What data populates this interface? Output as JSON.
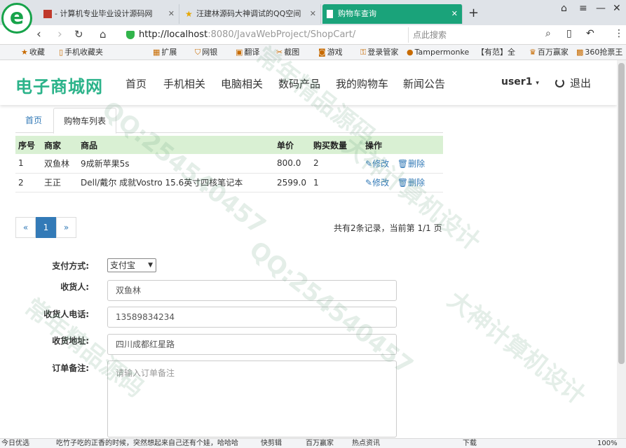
{
  "browser": {
    "tabs": [
      {
        "title": "- 计算机专业毕业设计源码网",
        "icon": "red-square-icon"
      },
      {
        "title": "汪建林源码大神调试的QQ空间",
        "icon": "star-icon"
      },
      {
        "title": "购物车查询",
        "icon": "page-icon"
      }
    ],
    "address": {
      "host": "http://localhost",
      "path": ":8080/JavaWebProject/ShopCart/"
    },
    "search_placeholder": "点此搜索",
    "bookmarks": [
      "收藏",
      "手机收藏夹",
      "扩展",
      "网银",
      "翻译",
      "截图",
      "游戏",
      "登录管家",
      "Tampermonke",
      "【有范】全",
      "百万赢家",
      "360抢票王"
    ],
    "status_items": [
      "今日优选",
      "吃竹子吃的正香的时候，突然想起来自己还有个娃，哈哈哈",
      "快剪辑",
      "百万赢家",
      "热点资讯",
      "下载",
      "100%"
    ]
  },
  "site": {
    "brand": "电子商城网",
    "nav": [
      "首页",
      "手机相关",
      "电脑相关",
      "数码产品",
      "我的购物车",
      "新闻公告"
    ],
    "user": "user1",
    "logout": "退出",
    "tabs": {
      "home": "首页",
      "current": "购物车列表"
    }
  },
  "cart": {
    "headers": [
      "序号",
      "商家",
      "商品",
      "单价",
      "购买数量",
      "操作"
    ],
    "rows": [
      {
        "no": "1",
        "shop": "双鱼林",
        "product": "9成新苹果5s",
        "price": "800.0",
        "qty": "2"
      },
      {
        "no": "2",
        "shop": "王正",
        "product": "Dell/戴尔 成就Vostro 15.6英寸四核笔记本",
        "price": "2599.0",
        "qty": "1"
      }
    ],
    "edit_label": "修改",
    "delete_label": "删除",
    "pager": {
      "prev": "«",
      "current": "1",
      "next": "»"
    },
    "record_info": "共有2条记录，当前第 1/1 页"
  },
  "order_form": {
    "payment_label": "支付方式:",
    "payment_value": "支付宝",
    "receiver_label": "收货人:",
    "receiver_value": "双鱼林",
    "phone_label": "收货人电话:",
    "phone_value": "13589834234",
    "address_label": "收货地址:",
    "address_value": "四川成都红星路",
    "note_label": "订单备注:",
    "note_placeholder": "请输入订单备注"
  },
  "watermarks": [
    "QQ:254540457",
    "大神计算机设计",
    "常年精品源码"
  ]
}
